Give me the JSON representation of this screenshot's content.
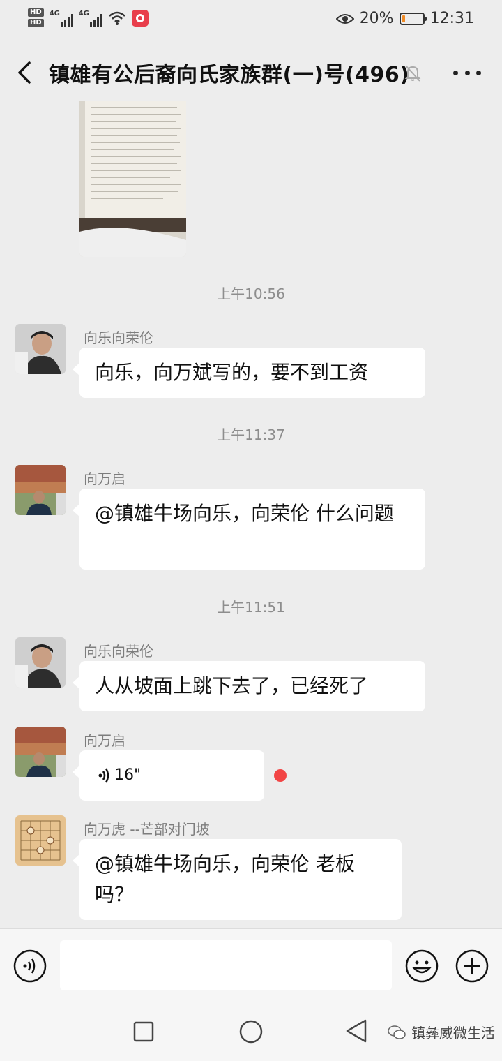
{
  "status_bar": {
    "hd1": "HD",
    "hd2": "HD",
    "net1": "4G",
    "net2": "4G",
    "battery_percent": "20%",
    "battery_level": 0.2,
    "time": "12:31",
    "icons": [
      "signal-icon",
      "wifi-icon",
      "screen-record-icon",
      "eye-icon",
      "battery-icon"
    ]
  },
  "header": {
    "title": "镇雄有公后裔向氏家族群(一)号(496)",
    "icons": [
      "back-icon",
      "mute-icon",
      "more-icon"
    ]
  },
  "timestamps": [
    "上午10:56",
    "上午11:37",
    "上午11:51"
  ],
  "messages": [
    {
      "sender": "向乐向荣伦",
      "text": "向乐，向万斌写的，要不到工资"
    },
    {
      "sender": "向万启",
      "text": "@镇雄牛场向乐，向荣伦  什么问题"
    },
    {
      "sender": "向乐向荣伦",
      "text": "人从坡面上跳下去了，已经死了"
    },
    {
      "sender": "向万启",
      "voice_duration": "16\""
    },
    {
      "sender": "向万虎  --芒部对门坡",
      "text": "@镇雄牛场向乐，向荣伦  老板吗？"
    }
  ],
  "input": {
    "placeholder": ""
  },
  "watermark": "镇彝威微生活",
  "colors": {
    "background": "#ededed",
    "bubble": "#ffffff",
    "unread_dot": "#f24545",
    "battery": "#f08a24"
  }
}
